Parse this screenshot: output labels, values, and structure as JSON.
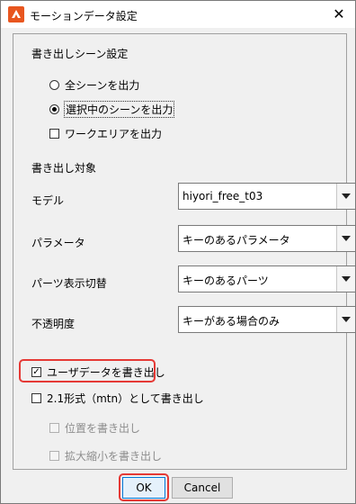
{
  "window": {
    "title": "モーションデータ設定",
    "close_glyph": "✕"
  },
  "scene_settings": {
    "heading": "書き出しシーン設定",
    "options": [
      {
        "label": "全シーンを出力",
        "selected": false
      },
      {
        "label": "選択中のシーンを出力",
        "selected": true
      }
    ],
    "work_area": {
      "label": "ワークエリアを出力",
      "checked": false
    }
  },
  "export_target": {
    "heading": "書き出し対象",
    "fields": [
      {
        "label": "モデル",
        "value": "hiyori_free_t03"
      },
      {
        "label": "パラメータ",
        "value": "キーのあるパラメータ"
      },
      {
        "label": "パーツ表示切替",
        "value": "キーのあるパーツ"
      },
      {
        "label": "不透明度",
        "value": "キーがある場合のみ"
      }
    ]
  },
  "options": {
    "user_data": {
      "label": "ユーザデータを書き出し",
      "checked": true
    },
    "mtn_format": {
      "label": "2.1形式（mtn）として書き出し",
      "checked": false
    },
    "position": {
      "label": "位置を書き出し",
      "checked": false,
      "disabled": true
    },
    "scale": {
      "label": "拡大縮小を書き出し",
      "checked": false,
      "disabled": true
    }
  },
  "buttons": {
    "ok": "OK",
    "cancel": "Cancel"
  },
  "colors": {
    "highlight": "#e53935",
    "accent": "#0078d7"
  },
  "icons": {
    "app": "cubism-logo-icon",
    "close": "close-icon",
    "dropdown": "chevron-down-icon"
  }
}
